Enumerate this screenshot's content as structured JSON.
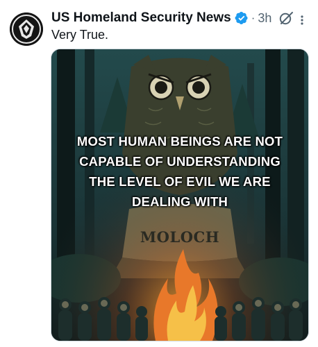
{
  "account": {
    "display_name": "US Homeland Security News",
    "verified": true,
    "avatar_icon": "shield-eagle-avatar-icon"
  },
  "meta": {
    "separator": "·",
    "time": "3h"
  },
  "tweet": {
    "text": "Very True."
  },
  "media": {
    "caption_lines": [
      "MOST HUMAN BEINGS ARE NOT",
      "CAPABLE OF UNDERSTANDING",
      "THE LEVEL OF EVIL WE ARE",
      "DEALING WITH"
    ],
    "statue_label": "MOLOCH"
  },
  "colors": {
    "verified_blue": "#1d9bf0",
    "text_primary": "#0f1419",
    "text_secondary": "#536471"
  },
  "icons": {
    "verified": "verified-badge-icon",
    "grok": "grok-icon",
    "more": "more-options-icon"
  }
}
